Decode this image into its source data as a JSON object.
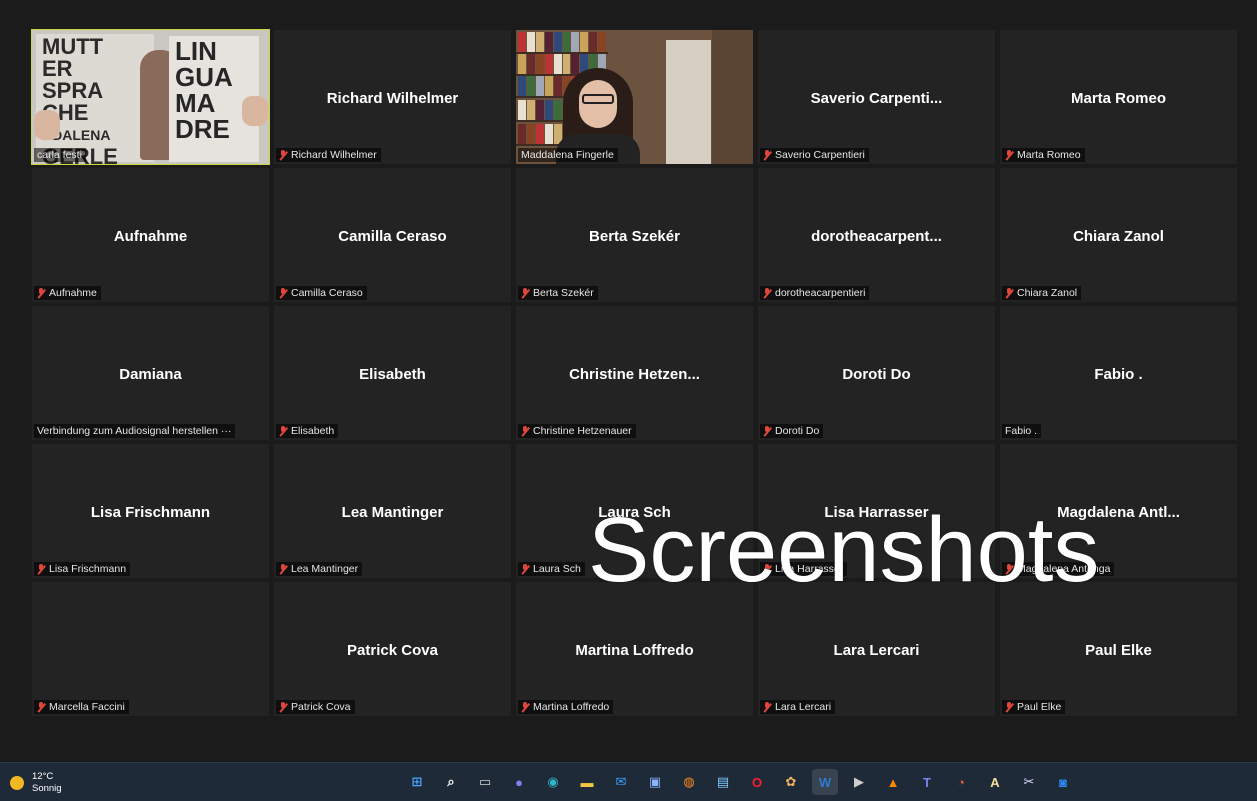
{
  "participants": [
    {
      "name": "",
      "label": "carla festi",
      "muted": false,
      "video": "books"
    },
    {
      "name": "Richard Wilhelmer",
      "label": "Richard Wilhelmer",
      "muted": true
    },
    {
      "name": "",
      "label": "Maddalena Fingerle",
      "muted": false,
      "video": "bookshelf"
    },
    {
      "name": "Saverio  Carpenti...",
      "label": "Saverio Carpentieri",
      "muted": true
    },
    {
      "name": "Marta Romeo",
      "label": "Marta Romeo",
      "muted": true
    },
    {
      "name": "Aufnahme",
      "label": "Aufnahme",
      "muted": true
    },
    {
      "name": "Camilla Ceraso",
      "label": "Camilla Ceraso",
      "muted": true
    },
    {
      "name": "Berta Szekér",
      "label": "Berta Szekér",
      "muted": true
    },
    {
      "name": "dorotheacarpent...",
      "label": "dorotheacarpentieri",
      "muted": true
    },
    {
      "name": "Chiara Zanol",
      "label": "Chiara Zanol",
      "muted": true
    },
    {
      "name": "Damiana",
      "label": "Verbindung zum Audiosignal herstellen ···",
      "muted": false
    },
    {
      "name": "Elisabeth",
      "label": "Elisabeth",
      "muted": true
    },
    {
      "name": "Christine  Hetzen...",
      "label": "Christine Hetzenauer",
      "muted": true
    },
    {
      "name": "Doroti Do",
      "label": "Doroti Do",
      "muted": true
    },
    {
      "name": "Fabio .",
      "label": "Fabio .",
      "muted": false
    },
    {
      "name": "Lisa Frischmann",
      "label": "Lisa Frischmann",
      "muted": true
    },
    {
      "name": "Lea Mantinger",
      "label": "Lea Mantinger",
      "muted": true
    },
    {
      "name": "Laura Sch",
      "label": "Laura Sch",
      "muted": true
    },
    {
      "name": "Lisa Harrasser",
      "label": "Lisa Harrasser",
      "muted": true
    },
    {
      "name": "Magdalena  Antl...",
      "label": "Magdalena Antonga",
      "muted": true
    },
    {
      "name": "",
      "label": "Marcella Faccini",
      "muted": true
    },
    {
      "name": "Patrick Cova",
      "label": "Patrick Cova",
      "muted": true
    },
    {
      "name": "Martina Loffredo",
      "label": "Martina Loffredo",
      "muted": true
    },
    {
      "name": "Lara Lercari",
      "label": "Lara Lercari",
      "muted": true
    },
    {
      "name": "Paul Elke",
      "label": "Paul Elke",
      "muted": true
    }
  ],
  "video_books": {
    "left_cover": [
      "MUTT",
      "ER",
      "SPRA",
      "CHE",
      "DDALENA",
      "GERLE"
    ],
    "right_cover": [
      "LIN",
      "GUA",
      "MA",
      "DRE"
    ]
  },
  "watermark": "Screenshots",
  "taskbar": {
    "weather_temp": "12°C",
    "weather_desc": "Sonnig",
    "apps": [
      {
        "icon": "windows-start-icon",
        "glyph": "⊞",
        "color": "#4aa3ff"
      },
      {
        "icon": "search-icon",
        "glyph": "⌕",
        "color": "#ffffff"
      },
      {
        "icon": "task-view-icon",
        "glyph": "▭",
        "color": "#d0d0d0"
      },
      {
        "icon": "chat-icon",
        "glyph": "●",
        "color": "#7b83eb"
      },
      {
        "icon": "edge-icon",
        "glyph": "◉",
        "color": "#2fb5c9"
      },
      {
        "icon": "file-explorer-icon",
        "glyph": "▬",
        "color": "#f4c542"
      },
      {
        "icon": "mail-icon",
        "glyph": "✉",
        "color": "#3aa0ff"
      },
      {
        "icon": "store-icon",
        "glyph": "▣",
        "color": "#8ab4ff"
      },
      {
        "icon": "firefox-icon",
        "glyph": "◍",
        "color": "#ff8a1f"
      },
      {
        "icon": "notepad-icon",
        "glyph": "▤",
        "color": "#7ec8ff"
      },
      {
        "icon": "opera-icon",
        "glyph": "O",
        "color": "#ff1b2d"
      },
      {
        "icon": "paint-icon",
        "glyph": "✿",
        "color": "#f0b060"
      },
      {
        "icon": "word-icon",
        "glyph": "W",
        "color": "#2b7cd3"
      },
      {
        "icon": "media-player-icon",
        "glyph": "▶",
        "color": "#cfcfcf"
      },
      {
        "icon": "vlc-icon",
        "glyph": "▲",
        "color": "#ff8800"
      },
      {
        "icon": "teams-icon",
        "glyph": "T",
        "color": "#7b83eb"
      },
      {
        "icon": "firefox-alt-icon",
        "glyph": "◔",
        "color": "#ff5a36"
      },
      {
        "icon": "font-app-icon",
        "glyph": "A",
        "color": "#f2e0a0"
      },
      {
        "icon": "snipping-tool-icon",
        "glyph": "✂",
        "color": "#e0e0ff"
      },
      {
        "icon": "zoom-icon",
        "glyph": "◙",
        "color": "#2d8cff"
      }
    ]
  },
  "colors": {
    "active_speaker_border": "#c9d63a",
    "mute_icon": "#e0463c",
    "taskbar_bg": "#1e2a38"
  }
}
